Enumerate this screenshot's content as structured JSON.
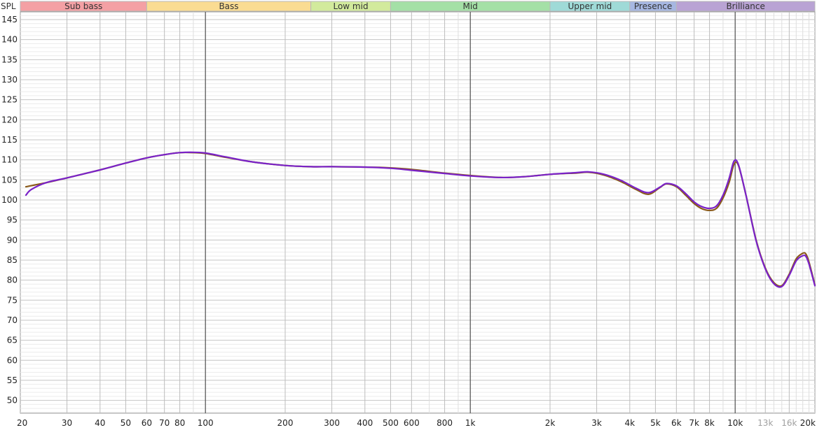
{
  "chart_data": {
    "type": "line",
    "ylabel": "SPL",
    "xscale": "log",
    "xlim": [
      20,
      20000
    ],
    "ylim": [
      45,
      147
    ],
    "y_ticks": [
      145,
      140,
      135,
      130,
      125,
      120,
      115,
      110,
      105,
      100,
      95,
      90,
      85,
      80,
      75,
      70,
      65,
      60,
      55,
      50
    ],
    "x_ticks": [
      {
        "value": 20,
        "label": "20"
      },
      {
        "value": 30,
        "label": "30"
      },
      {
        "value": 40,
        "label": "40"
      },
      {
        "value": 50,
        "label": "50"
      },
      {
        "value": 60,
        "label": "60"
      },
      {
        "value": 70,
        "label": "70"
      },
      {
        "value": 80,
        "label": "80"
      },
      {
        "value": 100,
        "label": "100"
      },
      {
        "value": 200,
        "label": "200"
      },
      {
        "value": 300,
        "label": "300"
      },
      {
        "value": 400,
        "label": "400"
      },
      {
        "value": 500,
        "label": "500"
      },
      {
        "value": 600,
        "label": "600"
      },
      {
        "value": 800,
        "label": "800"
      },
      {
        "value": 1000,
        "label": "1k"
      },
      {
        "value": 2000,
        "label": "2k"
      },
      {
        "value": 3000,
        "label": "3k"
      },
      {
        "value": 4000,
        "label": "4k"
      },
      {
        "value": 5000,
        "label": "5k"
      },
      {
        "value": 6000,
        "label": "6k"
      },
      {
        "value": 7000,
        "label": "7k"
      },
      {
        "value": 8000,
        "label": "8k"
      },
      {
        "value": 10000,
        "label": "10k"
      },
      {
        "value": 13000,
        "label": "13k",
        "muted": true
      },
      {
        "value": 16000,
        "label": "16k",
        "muted": true
      },
      {
        "value": 20000,
        "label": "20k"
      }
    ],
    "bands": [
      {
        "label": "Sub bass",
        "from": 20,
        "to": 60,
        "color": "#f4a0a4"
      },
      {
        "label": "Bass",
        "from": 60,
        "to": 250,
        "color": "#fadc92"
      },
      {
        "label": "Low mid",
        "from": 250,
        "to": 500,
        "color": "#d2ea9c"
      },
      {
        "label": "Mid",
        "from": 500,
        "to": 2000,
        "color": "#a4e0a6"
      },
      {
        "label": "Upper mid",
        "from": 2000,
        "to": 4000,
        "color": "#9fdad7"
      },
      {
        "label": "Presence",
        "from": 4000,
        "to": 6000,
        "color": "#a6b7e2"
      },
      {
        "label": "Brilliance",
        "from": 6000,
        "to": 20000,
        "color": "#b9a3d4"
      }
    ],
    "grid": true,
    "series": [
      {
        "color": "#8a5a1a",
        "x": [
          21,
          25,
          30,
          40,
          50,
          60,
          70,
          80,
          90,
          100,
          120,
          150,
          200,
          250,
          300,
          400,
          500,
          600,
          800,
          1000,
          1300,
          1600,
          2000,
          2500,
          2800,
          3200,
          3700,
          4200,
          4700,
          5200,
          5500,
          6000,
          6500,
          7000,
          7500,
          8000,
          8500,
          9000,
          9500,
          9900,
          10300,
          11000,
          12000,
          13000,
          14000,
          15000,
          16000,
          17000,
          18000,
          18500,
          19000,
          20000
        ],
        "y": [
          103.3,
          104.3,
          105.5,
          107.5,
          109.2,
          110.5,
          111.3,
          111.8,
          111.8,
          111.6,
          110.6,
          109.5,
          108.6,
          108.3,
          108.3,
          108.2,
          108.0,
          107.6,
          106.7,
          106.1,
          105.6,
          105.8,
          106.4,
          106.7,
          106.9,
          106.2,
          104.6,
          102.7,
          101.4,
          103.1,
          104.0,
          103.3,
          101.2,
          99.1,
          97.8,
          97.4,
          97.9,
          100.5,
          104.5,
          108.9,
          108.5,
          101.0,
          90.0,
          83.0,
          79.4,
          78.6,
          81.5,
          85.3,
          86.7,
          86.5,
          84.5,
          78.8
        ]
      },
      {
        "color": "#7a22c8",
        "x": [
          21,
          22,
          25,
          30,
          40,
          50,
          60,
          70,
          80,
          90,
          100,
          120,
          150,
          200,
          250,
          300,
          400,
          500,
          600,
          800,
          1000,
          1300,
          1600,
          2000,
          2500,
          2800,
          3200,
          3700,
          4200,
          4700,
          5200,
          5500,
          6000,
          6500,
          7000,
          7500,
          8000,
          8500,
          9000,
          9500,
          9900,
          10300,
          11000,
          12000,
          13000,
          14000,
          15000,
          16000,
          17000,
          18000,
          18500,
          19000,
          20000
        ],
        "y": [
          101.2,
          102.6,
          104.3,
          105.5,
          107.5,
          109.2,
          110.5,
          111.3,
          111.8,
          111.9,
          111.7,
          110.7,
          109.5,
          108.6,
          108.3,
          108.3,
          108.2,
          107.9,
          107.4,
          106.6,
          106.0,
          105.6,
          105.8,
          106.4,
          106.8,
          107.0,
          106.4,
          104.9,
          103.0,
          101.8,
          103.2,
          104.1,
          103.5,
          101.6,
          99.5,
          98.3,
          97.9,
          98.5,
          101.2,
          105.5,
          109.7,
          108.7,
          101.0,
          89.8,
          82.8,
          79.1,
          78.4,
          81.2,
          84.8,
          86.1,
          85.9,
          84.0,
          78.6
        ]
      }
    ]
  }
}
